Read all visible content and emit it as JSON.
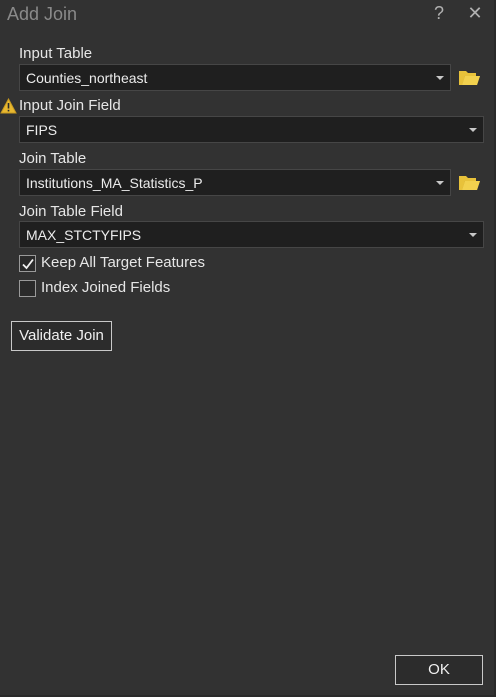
{
  "window": {
    "title": "Add Join",
    "help_label": "?",
    "close_label": "✕"
  },
  "form": {
    "input_table": {
      "label": "Input Table",
      "value": "Counties_northeast",
      "icon": "folder-icon"
    },
    "input_join_field": {
      "label": "Input Join Field",
      "value": "FIPS",
      "warning_icon": "warning-icon"
    },
    "join_table": {
      "label": "Join Table",
      "value": "Institutions_MA_Statistics_P",
      "icon": "folder-icon"
    },
    "join_table_field": {
      "label": "Join Table Field",
      "value": "MAX_STCTYFIPS"
    },
    "keep_all": {
      "label": "Keep All Target Features",
      "checked": true
    },
    "index_joined": {
      "label": "Index Joined Fields",
      "checked": false
    }
  },
  "buttons": {
    "validate_label": "Validate Join",
    "ok_label": "OK"
  },
  "colors": {
    "background": "#323232",
    "field_bg": "#1f1f1f",
    "folder": "#e8c23a",
    "warning": "#e8b830"
  }
}
